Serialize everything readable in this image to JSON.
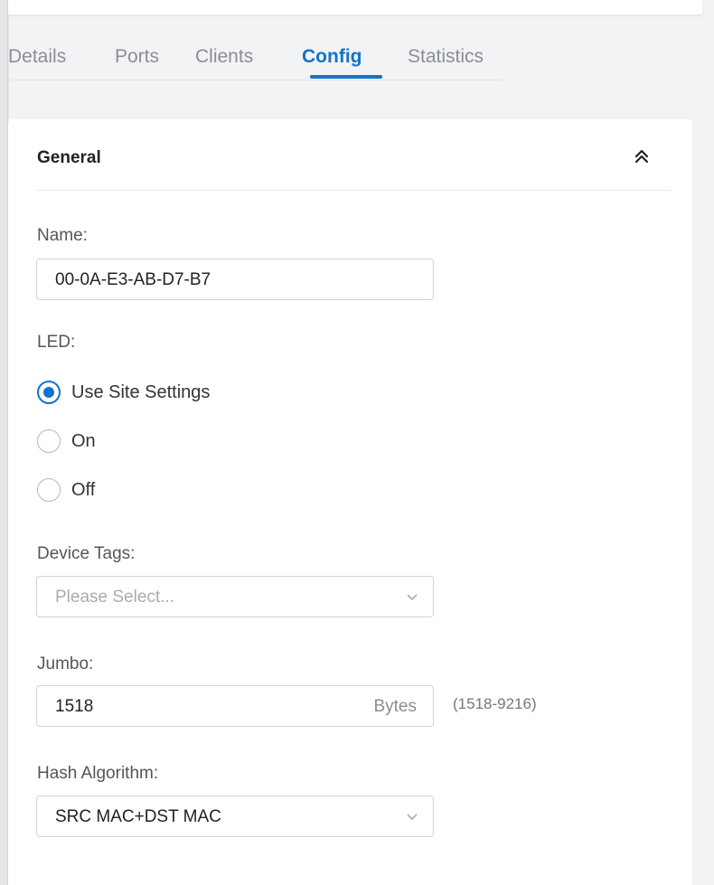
{
  "tabs": [
    {
      "label": "Details",
      "active": false
    },
    {
      "label": "Ports",
      "active": false
    },
    {
      "label": "Clients",
      "active": false
    },
    {
      "label": "Config",
      "active": true
    },
    {
      "label": "Statistics",
      "active": false
    }
  ],
  "general": {
    "title": "General",
    "collapse_icon": "double-chevron-up-icon",
    "name": {
      "label": "Name:",
      "value": "00-0A-E3-AB-D7-B7"
    },
    "led": {
      "label": "LED:",
      "options": [
        "Use Site Settings",
        "On",
        "Off"
      ],
      "selected": "Use Site Settings"
    },
    "device_tags": {
      "label": "Device Tags:",
      "placeholder": "Please Select..."
    },
    "jumbo": {
      "label": "Jumbo:",
      "value": "1518",
      "unit": "Bytes",
      "hint": "(1518-9216)"
    },
    "hash_algorithm": {
      "label": "Hash Algorithm:",
      "value": "SRC MAC+DST MAC"
    }
  },
  "colors": {
    "accent": "#1473c9",
    "text": "#333333",
    "muted": "#8a8e99",
    "border": "#d1d3d8",
    "background": "#f2f3f5"
  }
}
